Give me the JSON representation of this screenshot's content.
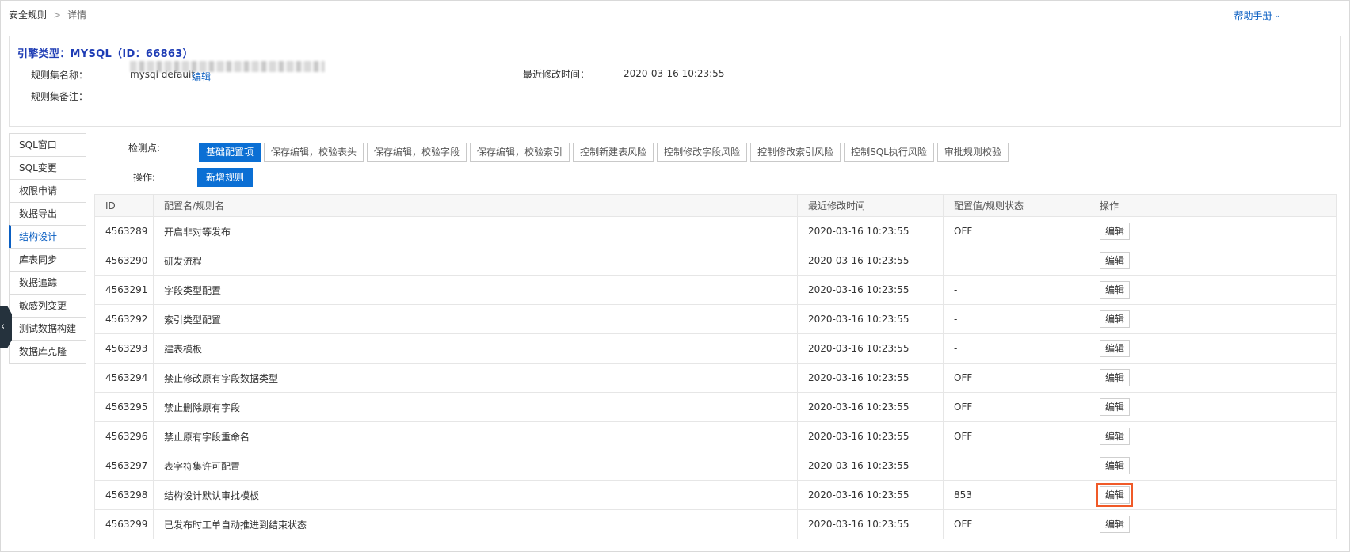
{
  "breadcrumb": {
    "root": "安全规则",
    "separator": ">",
    "current": "详情"
  },
  "help": {
    "label": "帮助手册",
    "icon": "chevron-down-icon"
  },
  "info": {
    "engine_title": "引擎类型：MYSQL（ID：66863）",
    "name_label": "规则集名称：",
    "name_value": "mysql default",
    "edit_link": "编辑",
    "modified_label": "最近修改时间：",
    "modified_value": "2020-03-16 10:23:55",
    "remark_label": "规则集备注："
  },
  "sidenav": {
    "items": [
      {
        "label": "SQL窗口"
      },
      {
        "label": "SQL变更"
      },
      {
        "label": "权限申请"
      },
      {
        "label": "数据导出"
      },
      {
        "label": "结构设计"
      },
      {
        "label": "库表同步"
      },
      {
        "label": "数据追踪"
      },
      {
        "label": "敏感列变更"
      },
      {
        "label": "测试数据构建"
      },
      {
        "label": "数据库克隆"
      }
    ],
    "active": "结构设计"
  },
  "checkpoints": {
    "label": "检测点:",
    "items": [
      "基础配置项",
      "保存编辑，校验表头",
      "保存编辑，校验字段",
      "保存编辑，校验索引",
      "控制新建表风险",
      "控制修改字段风险",
      "控制修改索引风险",
      "控制SQL执行风险",
      "审批规则校验"
    ],
    "active": "基础配置项"
  },
  "operations": {
    "label": "操作:",
    "add_rule": "新增规则"
  },
  "table": {
    "headers": [
      "ID",
      "配置名/规则名",
      "最近修改时间",
      "配置值/规则状态",
      "操作"
    ],
    "rows": [
      {
        "id": "4563289",
        "name": "开启非对等发布",
        "modified": "2020-03-16 10:23:55",
        "value": "OFF",
        "action": "编辑"
      },
      {
        "id": "4563290",
        "name": "研发流程",
        "modified": "2020-03-16 10:23:55",
        "value": "-",
        "action": "编辑"
      },
      {
        "id": "4563291",
        "name": "字段类型配置",
        "modified": "2020-03-16 10:23:55",
        "value": "-",
        "action": "编辑"
      },
      {
        "id": "4563292",
        "name": "索引类型配置",
        "modified": "2020-03-16 10:23:55",
        "value": "-",
        "action": "编辑"
      },
      {
        "id": "4563293",
        "name": "建表模板",
        "modified": "2020-03-16 10:23:55",
        "value": "-",
        "action": "编辑"
      },
      {
        "id": "4563294",
        "name": "禁止修改原有字段数据类型",
        "modified": "2020-03-16 10:23:55",
        "value": "OFF",
        "action": "编辑"
      },
      {
        "id": "4563295",
        "name": "禁止删除原有字段",
        "modified": "2020-03-16 10:23:55",
        "value": "OFF",
        "action": "编辑"
      },
      {
        "id": "4563296",
        "name": "禁止原有字段重命名",
        "modified": "2020-03-16 10:23:55",
        "value": "OFF",
        "action": "编辑"
      },
      {
        "id": "4563297",
        "name": "表字符集许可配置",
        "modified": "2020-03-16 10:23:55",
        "value": "-",
        "action": "编辑"
      },
      {
        "id": "4563298",
        "name": "结构设计默认审批模板",
        "modified": "2020-03-16 10:23:55",
        "value": "853",
        "action": "编辑",
        "highlighted": true
      },
      {
        "id": "4563299",
        "name": "已发布时工单自动推进到结束状态",
        "modified": "2020-03-16 10:23:55",
        "value": "OFF",
        "action": "编辑"
      }
    ]
  },
  "colors": {
    "accent": "#0b6fd4",
    "link": "#0b5fc2",
    "highlight": "#f05a28"
  }
}
